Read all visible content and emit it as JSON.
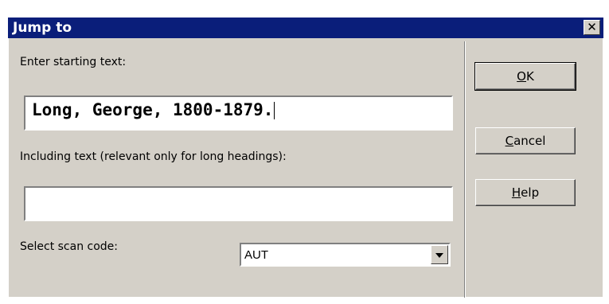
{
  "window": {
    "title": "Jump to",
    "close_glyph": "✕"
  },
  "form": {
    "starting_label": "Enter starting text:",
    "starting_value": "Long, George, 1800-1879.",
    "including_label": "Including text (relevant only for long headings):",
    "including_value": "",
    "scan_code_label": "Select scan code:",
    "scan_code_value": "AUT"
  },
  "buttons": {
    "ok": {
      "mnemonic": "O",
      "rest": "K"
    },
    "cancel": {
      "mnemonic": "C",
      "rest": "ancel"
    },
    "help": {
      "mnemonic": "H",
      "rest": "elp"
    }
  },
  "icons": {
    "close": "close-icon",
    "dropdown": "chevron-down-icon"
  },
  "colors": {
    "titlebar": "#0a1e7a",
    "face": "#d4d0c8"
  }
}
